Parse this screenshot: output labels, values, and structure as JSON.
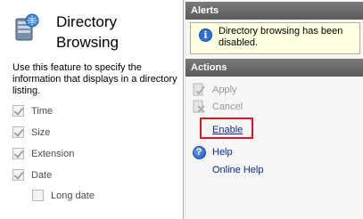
{
  "feature": {
    "title_line1": "Directory",
    "title_line2": "Browsing",
    "description": "Use this feature to specify the information that displays in a directory listing.",
    "icon": "directory-browsing-icon"
  },
  "options": [
    {
      "label": "Time",
      "checked": true
    },
    {
      "label": "Size",
      "checked": true
    },
    {
      "label": "Extension",
      "checked": true
    },
    {
      "label": "Date",
      "checked": true
    },
    {
      "label": "Long date",
      "checked": false
    }
  ],
  "alerts": {
    "header": "Alerts",
    "message": "Directory browsing has been disabled.",
    "icon": "info-icon"
  },
  "actions": {
    "header": "Actions",
    "apply": "Apply",
    "cancel": "Cancel",
    "enable": "Enable",
    "help": "Help",
    "online_help": "Online Help"
  },
  "colors": {
    "highlight": "#e0141e",
    "link": "#0a2a9a",
    "header_bg": "#6b6b6b",
    "alert_bg": "#ffffe1"
  }
}
